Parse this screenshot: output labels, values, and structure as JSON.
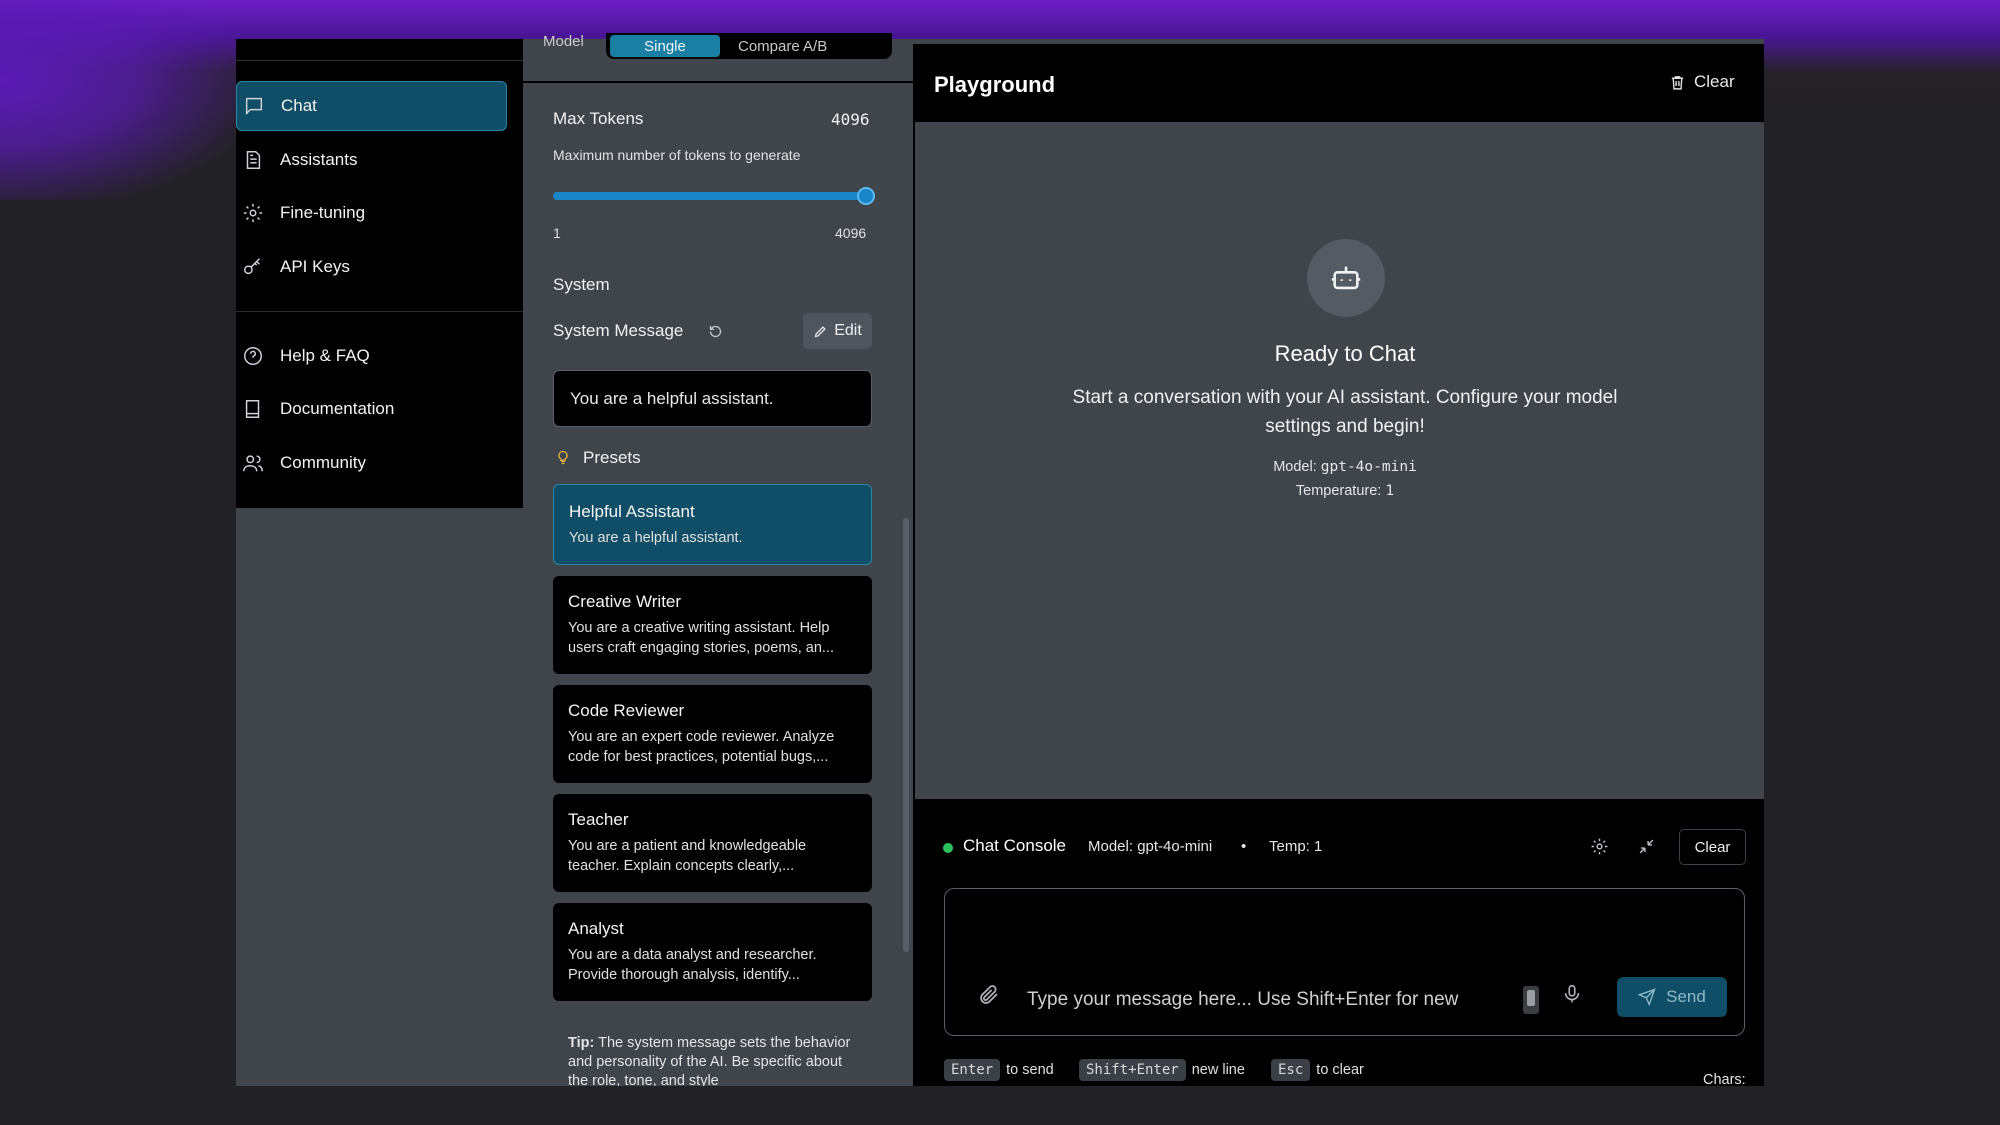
{
  "mode": {
    "label": "Model",
    "options": [
      "Single",
      "Compare A/B"
    ],
    "selected": "Single"
  },
  "sidebar": {
    "items": [
      {
        "label": "Chat",
        "icon": "chat-icon",
        "active": true
      },
      {
        "label": "Assistants",
        "icon": "document-icon"
      },
      {
        "label": "Fine-tuning",
        "icon": "gear-icon"
      },
      {
        "label": "API Keys",
        "icon": "key-icon"
      }
    ],
    "help_items": [
      {
        "label": "Help & FAQ",
        "icon": "help-circle-icon"
      },
      {
        "label": "Documentation",
        "icon": "book-icon"
      },
      {
        "label": "Community",
        "icon": "users-icon"
      }
    ]
  },
  "settings": {
    "max_tokens": {
      "label": "Max Tokens",
      "value": "4096",
      "description": "Maximum number of tokens to generate",
      "min": "1",
      "max": "4096",
      "fill_fraction": 1.0
    },
    "system_heading": "System",
    "system_message_label": "System Message",
    "edit_label": "Edit",
    "system_message_value": "You are a helpful assistant.",
    "presets_heading": "Presets",
    "presets": [
      {
        "title": "Helpful Assistant",
        "desc": "You are a helpful assistant.",
        "active": true
      },
      {
        "title": "Creative Writer",
        "desc": "You are a creative writing assistant. Help users craft engaging stories, poems, an..."
      },
      {
        "title": "Code Reviewer",
        "desc": "You are an expert code reviewer. Analyze code for best practices, potential bugs,..."
      },
      {
        "title": "Teacher",
        "desc": "You are a patient and knowledgeable teacher. Explain concepts clearly,..."
      },
      {
        "title": "Analyst",
        "desc": "You are a data analyst and researcher. Provide thorough analysis, identify..."
      }
    ],
    "tip_label": "Tip:",
    "tip_text": "The system message sets the behavior and personality of the AI. Be specific about the role, tone, and style"
  },
  "main": {
    "title": "Playground",
    "clear_label": "Clear",
    "empty_title": "Ready to Chat",
    "empty_desc": "Start a conversation with your AI assistant. Configure your model settings and begin!",
    "model_label": "Model:",
    "model_value": "gpt-4o-mini",
    "temp_label": "Temperature:",
    "temp_value": "1"
  },
  "console": {
    "title": "Chat Console",
    "model": "Model: gpt-4o-mini",
    "separator": "•",
    "temp": "Temp: 1",
    "clear_label": "Clear",
    "placeholder": "Type your message here... Use Shift+Enter for new",
    "send_label": "Send",
    "hints": [
      {
        "key": "Enter",
        "text": "to send"
      },
      {
        "key": "Shift+Enter",
        "text": "new line"
      },
      {
        "key": "Esc",
        "text": "to clear"
      }
    ],
    "chars_label": "Chars:"
  },
  "colors": {
    "accent": "#0f4e66",
    "accent_border": "#2b86a6",
    "status_online": "#2ec25c",
    "slider": "#1a86c8"
  }
}
